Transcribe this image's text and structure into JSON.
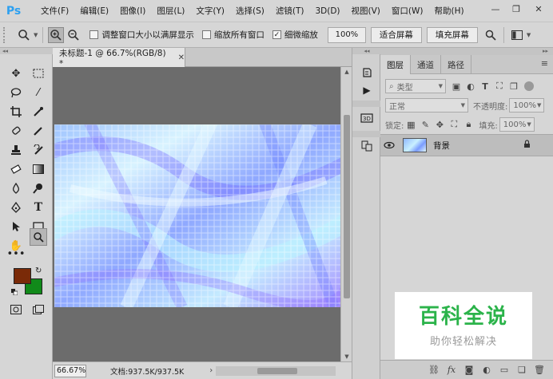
{
  "app": {
    "logo": "Ps"
  },
  "menu": [
    "文件(F)",
    "编辑(E)",
    "图像(I)",
    "图层(L)",
    "文字(Y)",
    "选择(S)",
    "滤镜(T)",
    "3D(D)",
    "视图(V)",
    "窗口(W)",
    "帮助(H)"
  ],
  "options": {
    "resize_windows_label": "调整窗口大小以满屏显示",
    "resize_windows_checked": false,
    "zoom_all_label": "缩放所有窗口",
    "zoom_all_checked": false,
    "scrubby_zoom_label": "细微缩放",
    "scrubby_zoom_checked": true,
    "zoom_value": "100%",
    "fit_screen_label": "适合屏幕",
    "fill_screen_label": "填充屏幕"
  },
  "document": {
    "tab_title": "未标题-1 @ 66.7%(RGB/8) *",
    "zoom": "66.67%",
    "doc_size": "文档:937.5K/937.5K"
  },
  "colors": {
    "foreground": "#7a2a08",
    "background": "#118a1a",
    "accent": "#2da0f0"
  },
  "layers_panel": {
    "tabs": [
      "图层",
      "通道",
      "路径"
    ],
    "active_tab": 0,
    "filter_label": "类型",
    "blend_mode": "正常",
    "opacity_label": "不透明度:",
    "opacity_value": "100%",
    "lock_label": "锁定:",
    "fill_label": "填充:",
    "fill_value": "100%",
    "layers": [
      {
        "name": "背景",
        "visible": true,
        "locked": true
      }
    ]
  },
  "watermark": {
    "title": "百科全说",
    "subtitle": "助你轻松解决"
  }
}
